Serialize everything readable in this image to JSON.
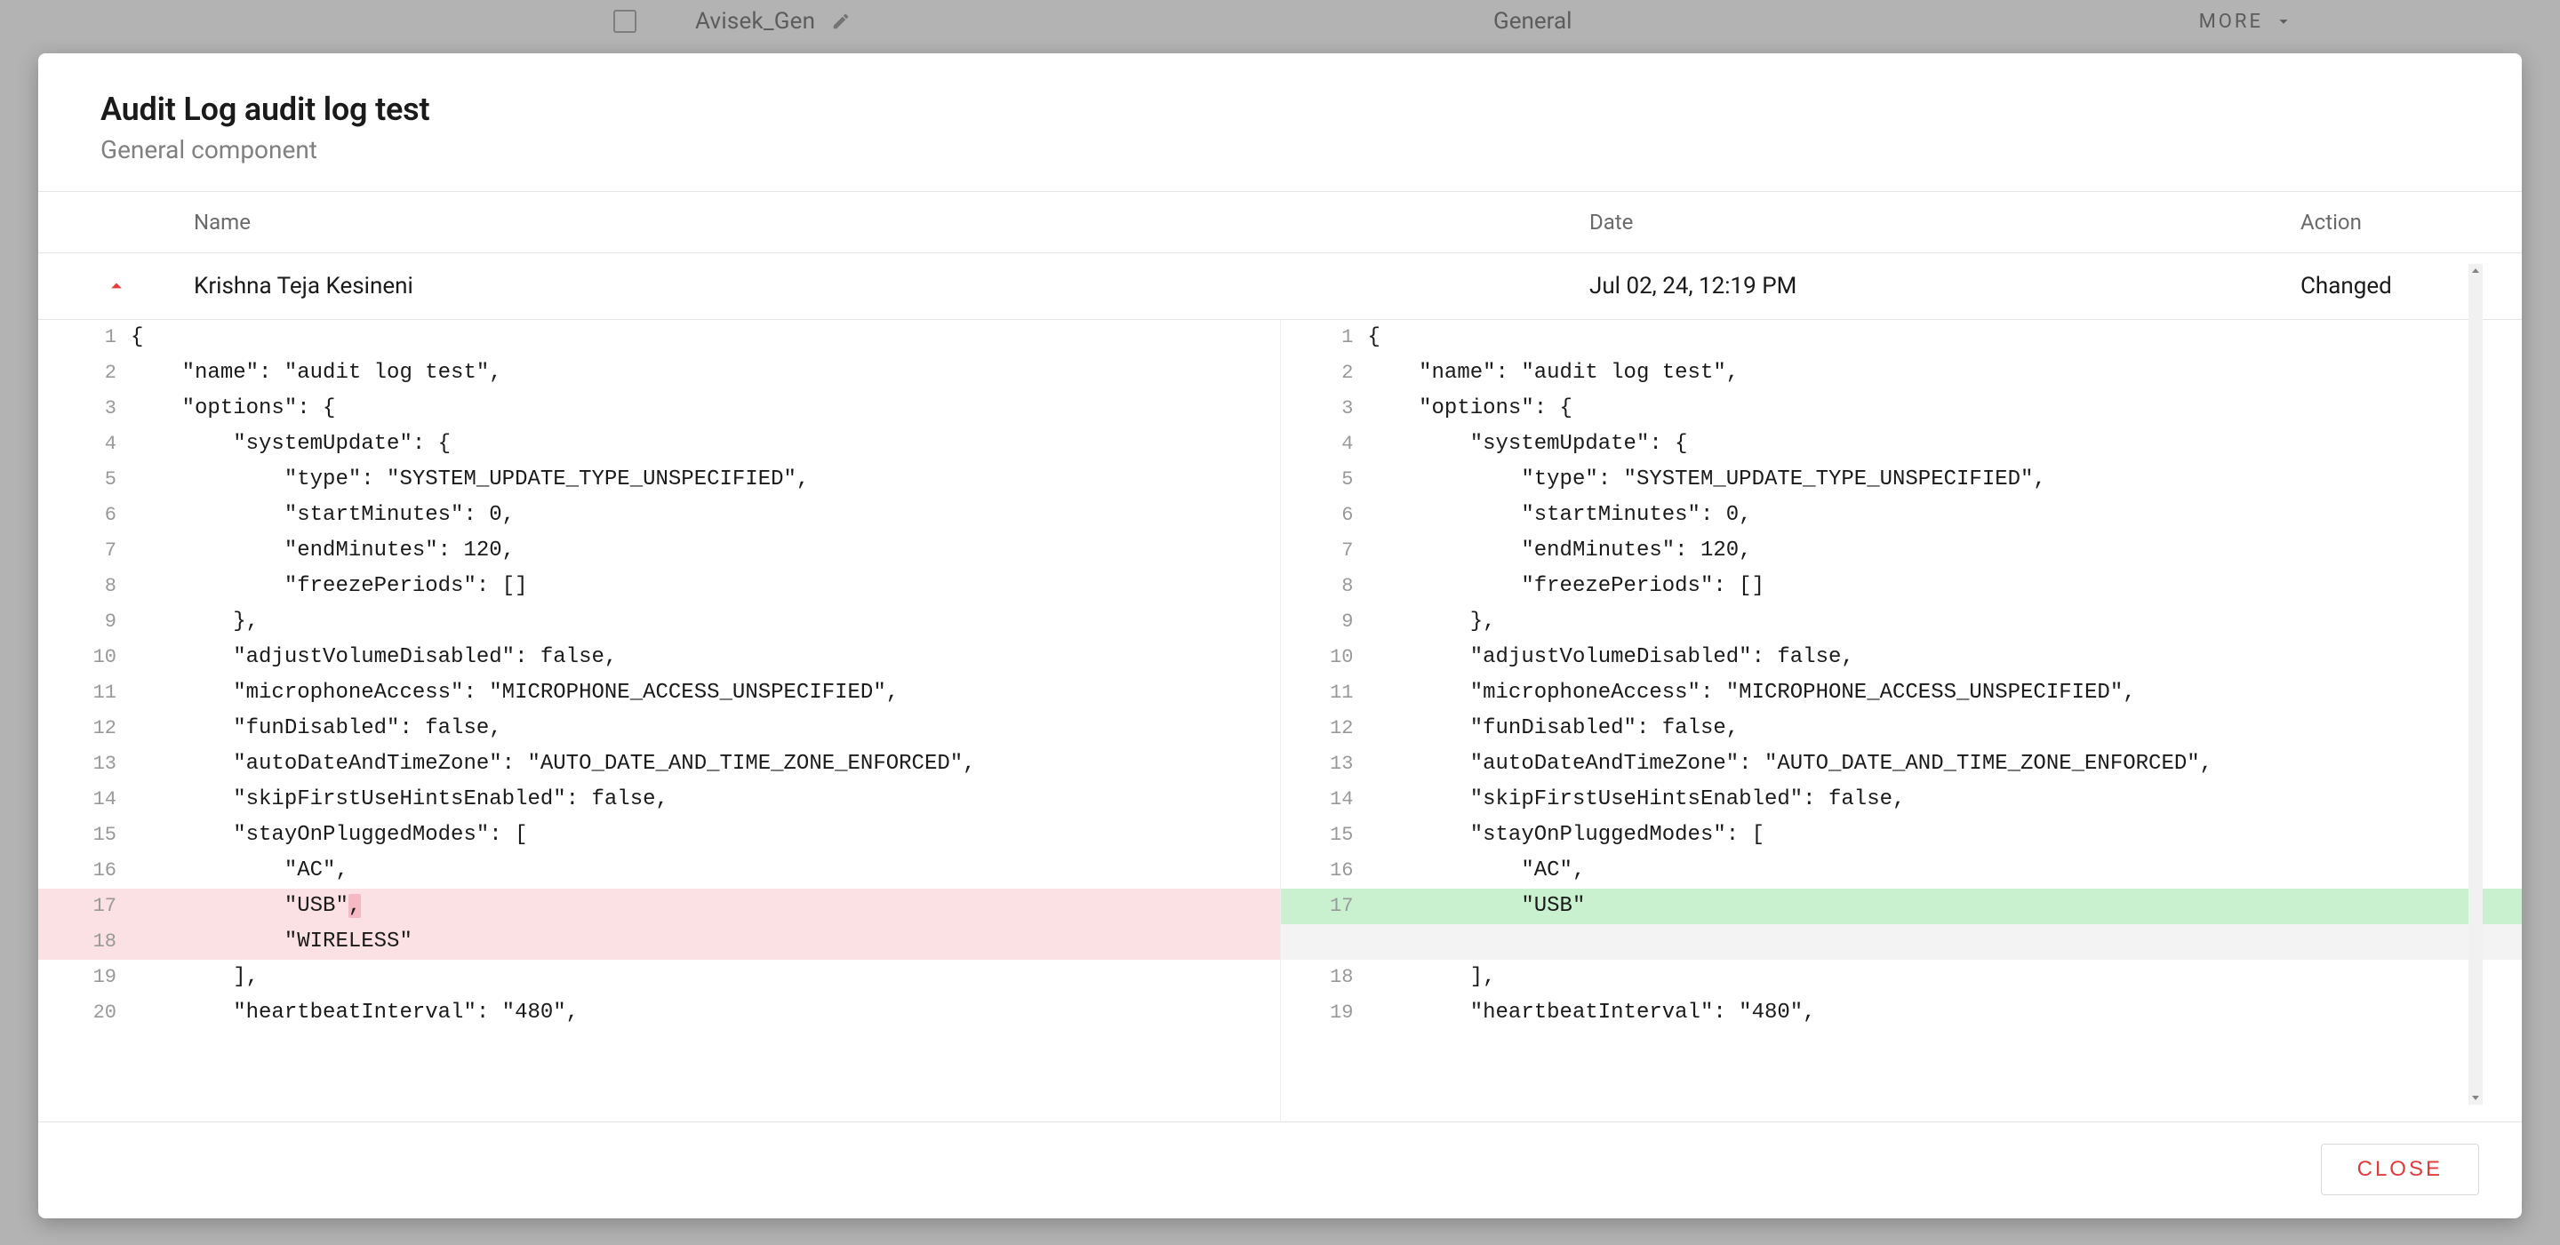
{
  "background": {
    "row_name": "Avisek_Gen",
    "category": "General",
    "more_label": "MORE"
  },
  "modal": {
    "title": "Audit Log audit log test",
    "subtitle": "General component",
    "columns": {
      "name": "Name",
      "date": "Date",
      "action": "Action"
    },
    "entry": {
      "user": "Krishna Teja Kesineni",
      "date": "Jul 02, 24, 12:19 PM",
      "action": "Changed"
    },
    "close_label": "CLOSE"
  },
  "diff": {
    "left": [
      {
        "n": 1,
        "t": "{"
      },
      {
        "n": 2,
        "t": "    \"name\": \"audit log test\","
      },
      {
        "n": 3,
        "t": "    \"options\": {"
      },
      {
        "n": 4,
        "t": "        \"systemUpdate\": {"
      },
      {
        "n": 5,
        "t": "            \"type\": \"SYSTEM_UPDATE_TYPE_UNSPECIFIED\","
      },
      {
        "n": 6,
        "t": "            \"startMinutes\": 0,"
      },
      {
        "n": 7,
        "t": "            \"endMinutes\": 120,"
      },
      {
        "n": 8,
        "t": "            \"freezePeriods\": []"
      },
      {
        "n": 9,
        "t": "        },"
      },
      {
        "n": 10,
        "t": "        \"adjustVolumeDisabled\": false,"
      },
      {
        "n": 11,
        "t": "        \"microphoneAccess\": \"MICROPHONE_ACCESS_UNSPECIFIED\","
      },
      {
        "n": 12,
        "t": "        \"funDisabled\": false,"
      },
      {
        "n": 13,
        "t": "        \"autoDateAndTimeZone\": \"AUTO_DATE_AND_TIME_ZONE_ENFORCED\","
      },
      {
        "n": 14,
        "t": "        \"skipFirstUseHintsEnabled\": false,"
      },
      {
        "n": 15,
        "t": "        \"stayOnPluggedModes\": ["
      },
      {
        "n": 16,
        "t": "            \"AC\","
      },
      {
        "n": 17,
        "t": "            \"USB\",",
        "kind": "removed-inline",
        "inline_removed": ","
      },
      {
        "n": 18,
        "t": "            \"WIRELESS\"",
        "kind": "removed"
      },
      {
        "n": 19,
        "t": "        ],"
      },
      {
        "n": 20,
        "t": "        \"heartbeatInterval\": \"480\","
      }
    ],
    "right": [
      {
        "n": 1,
        "t": "{"
      },
      {
        "n": 2,
        "t": "    \"name\": \"audit log test\","
      },
      {
        "n": 3,
        "t": "    \"options\": {"
      },
      {
        "n": 4,
        "t": "        \"systemUpdate\": {"
      },
      {
        "n": 5,
        "t": "            \"type\": \"SYSTEM_UPDATE_TYPE_UNSPECIFIED\","
      },
      {
        "n": 6,
        "t": "            \"startMinutes\": 0,"
      },
      {
        "n": 7,
        "t": "            \"endMinutes\": 120,"
      },
      {
        "n": 8,
        "t": "            \"freezePeriods\": []"
      },
      {
        "n": 9,
        "t": "        },"
      },
      {
        "n": 10,
        "t": "        \"adjustVolumeDisabled\": false,"
      },
      {
        "n": 11,
        "t": "        \"microphoneAccess\": \"MICROPHONE_ACCESS_UNSPECIFIED\","
      },
      {
        "n": 12,
        "t": "        \"funDisabled\": false,"
      },
      {
        "n": 13,
        "t": "        \"autoDateAndTimeZone\": \"AUTO_DATE_AND_TIME_ZONE_ENFORCED\","
      },
      {
        "n": 14,
        "t": "        \"skipFirstUseHintsEnabled\": false,"
      },
      {
        "n": 15,
        "t": "        \"stayOnPluggedModes\": ["
      },
      {
        "n": 16,
        "t": "            \"AC\","
      },
      {
        "n": 17,
        "t": "            \"USB\"",
        "kind": "added"
      },
      {
        "n": "",
        "t": "",
        "kind": "filler"
      },
      {
        "n": 18,
        "t": "        ],"
      },
      {
        "n": 19,
        "t": "        \"heartbeatInterval\": \"480\","
      }
    ]
  }
}
